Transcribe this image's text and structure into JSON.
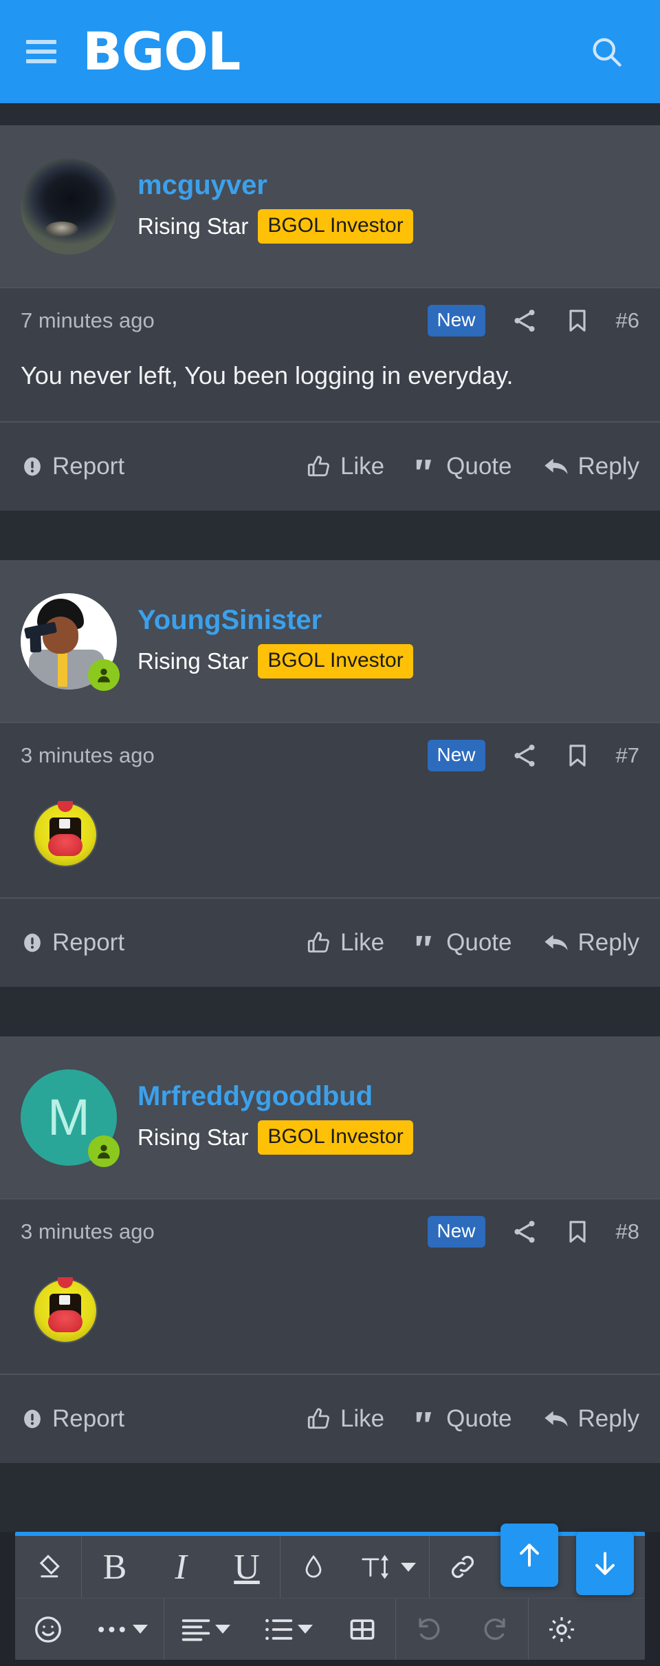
{
  "appbar": {
    "menu_icon": "hamburger-menu-icon",
    "brand": "BGOL",
    "search_icon": "search-icon",
    "background_color": "#2196f3"
  },
  "theme": {
    "page_background": "#22262c",
    "post_background": "#3b4049",
    "post_header_background": "#474c55",
    "accent_blue": "#2196f3",
    "username_blue": "#3ba1ec",
    "badge_yellow": "#ffc107",
    "new_badge_blue": "#2d6bbd",
    "online_green": "#8bc91e"
  },
  "posts": [
    {
      "username": "mcguyver",
      "avatar_type": "image",
      "avatar_art": "black-panther-photo",
      "avatar_letter": "",
      "online": false,
      "rank": "Rising Star",
      "badge": "BGOL Investor",
      "timestamp": "7 minutes ago",
      "new_label": "New",
      "share_icon": "share-icon",
      "bookmark_icon": "bookmark-icon",
      "post_number": "#6",
      "body_type": "text",
      "body_text": "You never left, You been logging in everyday.",
      "actions": {
        "report": "Report",
        "like": "Like",
        "quote": "Quote",
        "reply": "Reply"
      }
    },
    {
      "username": "YoungSinister",
      "avatar_type": "cartoon",
      "avatar_art": "cartoon-man-with-gun",
      "avatar_letter": "",
      "online": true,
      "rank": "Rising Star",
      "badge": "BGOL Investor",
      "timestamp": "3 minutes ago",
      "new_label": "New",
      "share_icon": "share-icon",
      "bookmark_icon": "bookmark-icon",
      "post_number": "#7",
      "body_type": "emoji",
      "body_text": "",
      "emoji_name": "laughing-crying-emoji",
      "actions": {
        "report": "Report",
        "like": "Like",
        "quote": "Quote",
        "reply": "Reply"
      }
    },
    {
      "username": "Mrfreddygoodbud",
      "avatar_type": "letter",
      "avatar_art": "",
      "avatar_letter": "M",
      "online": true,
      "rank": "Rising Star",
      "badge": "BGOL Investor",
      "timestamp": "3 minutes ago",
      "new_label": "New",
      "share_icon": "share-icon",
      "bookmark_icon": "bookmark-icon",
      "post_number": "#8",
      "body_type": "emoji",
      "body_text": "",
      "emoji_name": "laughing-crying-emoji",
      "actions": {
        "report": "Report",
        "like": "Like",
        "quote": "Quote",
        "reply": "Reply"
      }
    }
  ],
  "editor": {
    "row1": [
      {
        "name": "remove-formatting-icon",
        "label": ""
      },
      {
        "name": "bold-icon",
        "label": "B"
      },
      {
        "name": "italic-icon",
        "label": "I"
      },
      {
        "name": "underline-icon",
        "label": "U"
      },
      {
        "name": "text-color-icon",
        "label": ""
      },
      {
        "name": "font-size-icon",
        "label": "T"
      },
      {
        "name": "link-icon",
        "label": ""
      },
      {
        "name": "insert-image-icon",
        "label": ""
      }
    ],
    "row2": [
      {
        "name": "emoji-icon",
        "label": ""
      },
      {
        "name": "more-options-icon",
        "label": ""
      },
      {
        "name": "text-align-icon",
        "label": ""
      },
      {
        "name": "list-icon",
        "label": ""
      },
      {
        "name": "table-icon",
        "label": ""
      },
      {
        "name": "undo-icon",
        "label": ""
      },
      {
        "name": "redo-icon",
        "label": ""
      },
      {
        "name": "settings-gear-icon",
        "label": ""
      }
    ],
    "scroll_up": "scroll-up-button",
    "scroll_down": "scroll-down-button"
  }
}
